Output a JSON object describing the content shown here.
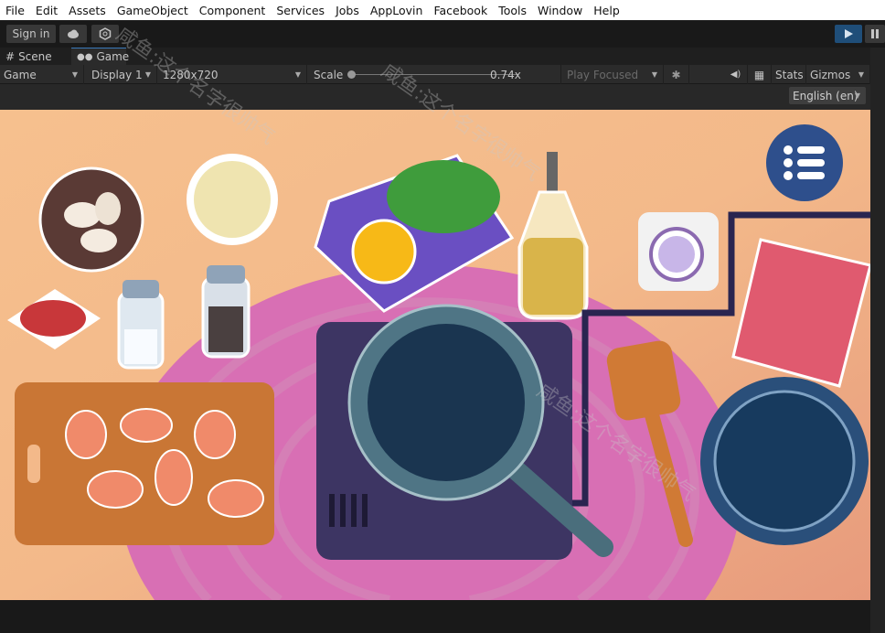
{
  "menu": [
    "File",
    "Edit",
    "Assets",
    "GameObject",
    "Component",
    "Services",
    "Jobs",
    "AppLovin",
    "Facebook",
    "Tools",
    "Window",
    "Help"
  ],
  "toolbar": {
    "sign_in": "Sign in",
    "cloud_icon": "cloud-icon",
    "services_icon": "gear-hex-icon",
    "play_icon": "play-icon",
    "pause_icon": "pause-icon",
    "play_color": "#1f4e79"
  },
  "tabs": [
    {
      "label": "Scene",
      "icon": "grid-icon"
    },
    {
      "label": "Game",
      "icon": "gamepad-icon"
    }
  ],
  "gamebar": {
    "view": "Game",
    "display": "Display 1",
    "resolution": "1280x720",
    "scale_label": "Scale",
    "scale_value": "0.74x",
    "play_mode": "Play Focused",
    "stats": "Stats",
    "gizmos": "Gizmos"
  },
  "language": "English (en)",
  "watermark": "咸鱼:这个名字很帅气"
}
